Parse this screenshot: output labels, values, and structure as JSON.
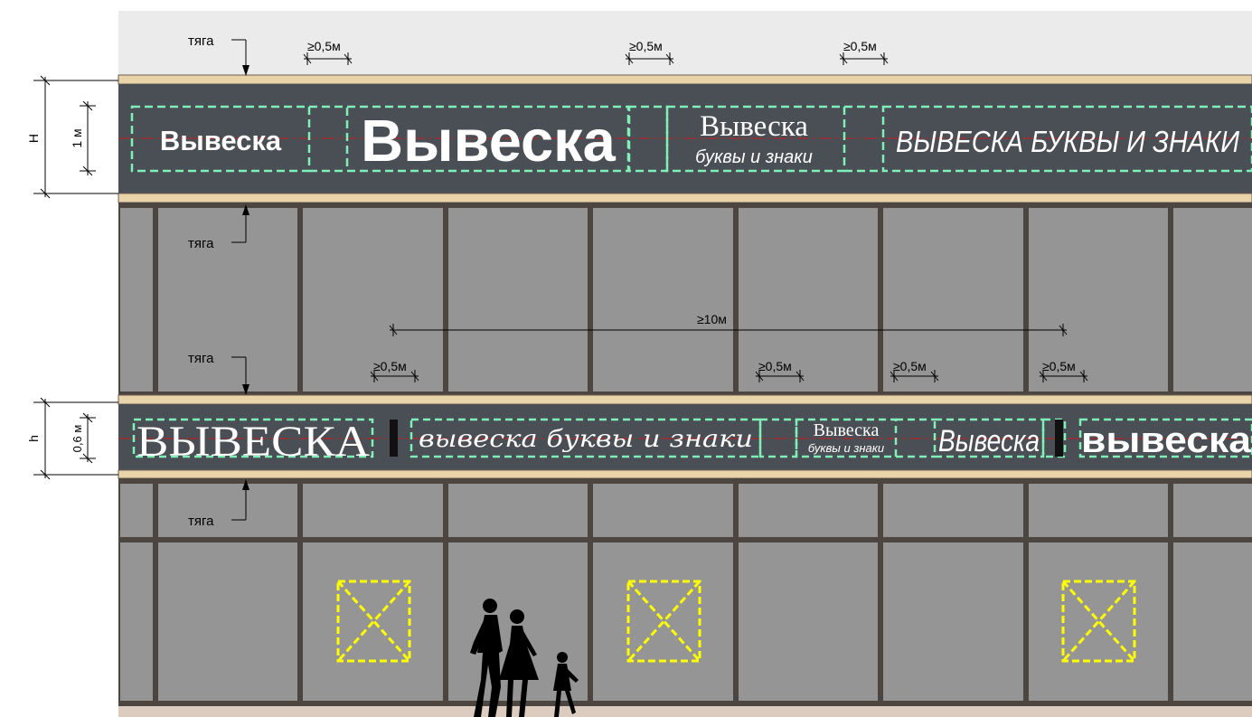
{
  "dimensions": {
    "big_sign_zone_label": "H",
    "big_letter_height": "1 м",
    "small_sign_zone_label": "h",
    "small_letter_height": "0,6 м",
    "min_gap": "≥0,5м",
    "min_distance": "≥10м"
  },
  "labels": {
    "rod": "тяга"
  },
  "upper_band": {
    "sign_1": "Вывеска",
    "sign_2": "Вывеска",
    "sign_3_title": "Вывеска",
    "sign_3_subtitle": "буквы и знаки",
    "sign_4": "ВЫВЕСКА БУКВЫ И ЗНАКИ"
  },
  "lower_band": {
    "sign_1": "ВЫВЕСКА",
    "sign_2": "вывеска буквы и знаки",
    "sign_3_title": "Вывеска",
    "sign_3_subtitle": "буквы и знаки",
    "sign_4": "Вывеска",
    "sign_5": "вывеска"
  },
  "colors": {
    "background": "#ebebeb",
    "sign_band": "#4a4f55",
    "wall": "#959595",
    "cornice": "#e9d3a8",
    "frame": "#4d4640",
    "sign_zone_border": "#7ef0b8",
    "axis_line": "#c81e1e",
    "emergency_marker": "#ffff00"
  }
}
